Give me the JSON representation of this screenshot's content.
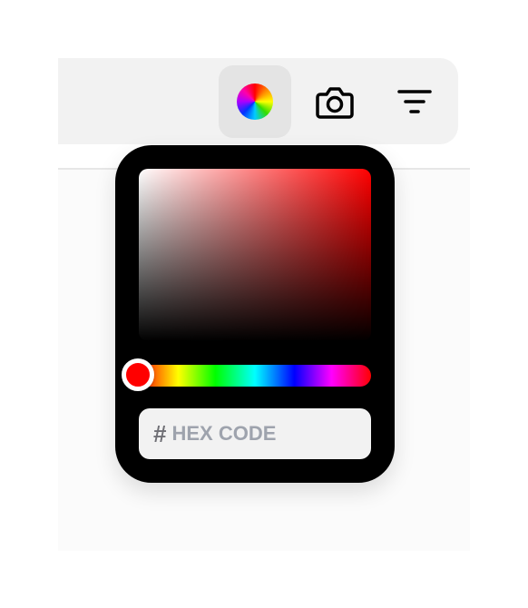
{
  "toolbar": {
    "buttons": [
      {
        "id": "color",
        "icon": "color-wheel-icon",
        "active": true
      },
      {
        "id": "camera",
        "icon": "camera-icon",
        "active": false
      },
      {
        "id": "filter",
        "icon": "filter-icon",
        "active": false
      }
    ]
  },
  "color_picker": {
    "hue_color": "#ff0000",
    "hex_prefix": "#",
    "hex_value": "",
    "hex_placeholder": "HEX CODE"
  }
}
